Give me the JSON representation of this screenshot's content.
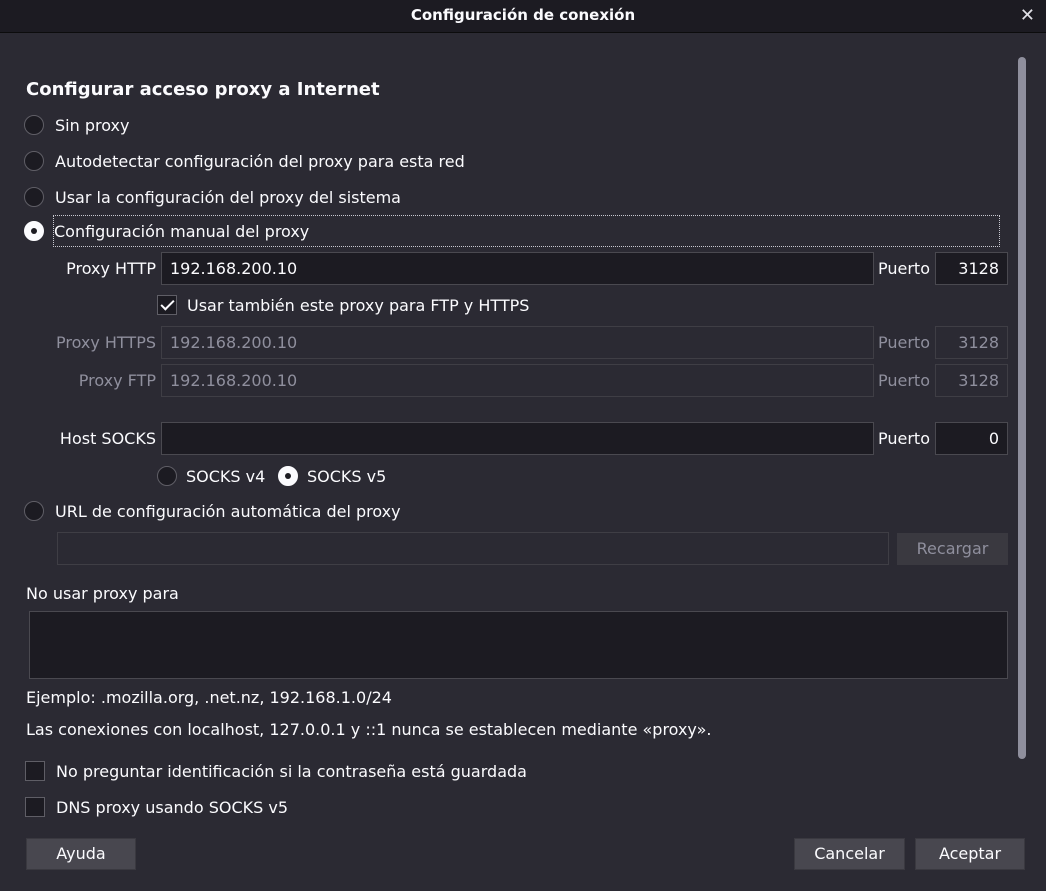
{
  "window": {
    "title": "Configuración de conexión",
    "close_icon": "close-icon"
  },
  "section_title": "Configurar acceso proxy a Internet",
  "proxy_modes": [
    {
      "label": "Sin proxy",
      "selected": false
    },
    {
      "label": "Autodetectar configuración del proxy para esta red",
      "selected": false
    },
    {
      "label": "Usar la configuración del proxy del sistema",
      "selected": false
    },
    {
      "label": "Configuración manual del proxy",
      "selected": true
    }
  ],
  "manual": {
    "http_label": "Proxy HTTP",
    "http_value": "192.168.200.10",
    "port_label": "Puerto",
    "http_port": "3128",
    "also_use_label": "Usar también este proxy para FTP y HTTPS",
    "also_use_checked": true,
    "https_label": "Proxy HTTPS",
    "https_value": "192.168.200.10",
    "https_port": "3128",
    "ftp_label": "Proxy FTP",
    "ftp_value": "192.168.200.10",
    "ftp_port": "3128",
    "socks_label": "Host SOCKS",
    "socks_value": "",
    "socks_port": "0",
    "socks_v4_label": "SOCKS v4",
    "socks_v5_label": "SOCKS v5",
    "socks_version_selected": "v5"
  },
  "auto_url": {
    "label": "URL de configuración automática del proxy",
    "selected": false,
    "value": "",
    "reload_label": "Recargar"
  },
  "no_proxy": {
    "label": "No usar proxy para",
    "value": "",
    "example": "Ejemplo: .mozilla.org, .net.nz, 192.168.1.0/24",
    "note": "Las conexiones con localhost, 127.0.0.1 y ::1 nunca se establecen mediante «proxy»."
  },
  "options": [
    {
      "label": "No preguntar identificación si la contraseña está guardada",
      "checked": false
    },
    {
      "label": "DNS proxy usando SOCKS v5",
      "checked": false
    }
  ],
  "buttons": {
    "help": "Ayuda",
    "cancel": "Cancelar",
    "accept": "Aceptar"
  }
}
